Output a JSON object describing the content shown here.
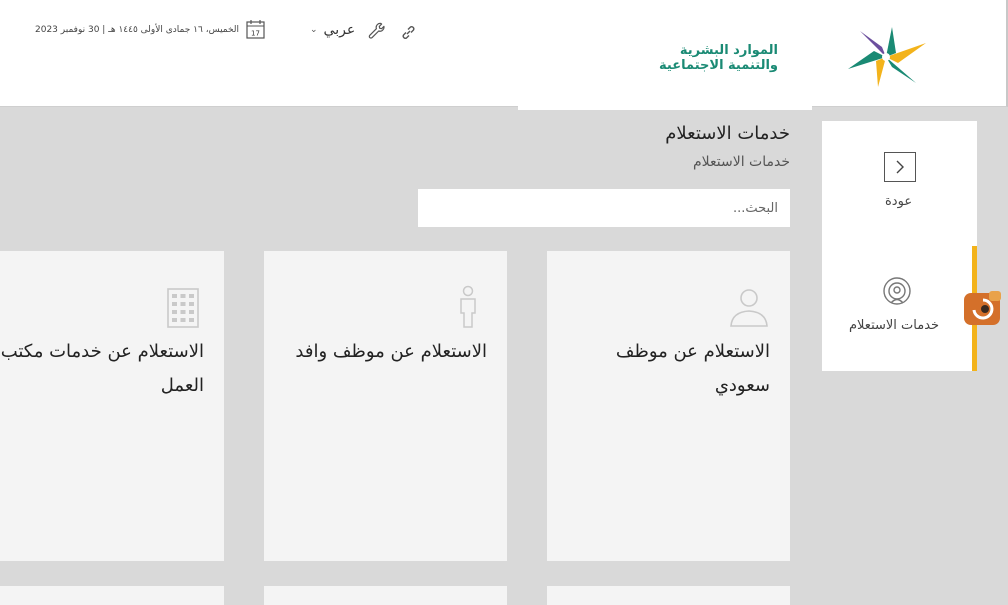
{
  "header": {
    "date": "الخميس، ١٦ جمادى الأولى ١٤٤٥ هـ | 30 نوفمبر 2023",
    "calendar_day": "17",
    "language": "عربي",
    "logo_line1": "الموارد البشرية",
    "logo_line2": "والتنمية الاجتماعية"
  },
  "sidebar": {
    "back_label": "عودة",
    "inquiry_label": "خدمات الاستعلام"
  },
  "main": {
    "title": "خدمات الاستعلام",
    "breadcrumb": "خدمات الاستعلام",
    "search_placeholder": "البحث...",
    "cards": [
      {
        "label": "الاستعلام عن موظف سعودي",
        "icon": "person-icon"
      },
      {
        "label": "الاستعلام عن موظف وافد",
        "icon": "standing-person-icon"
      },
      {
        "label": "الاستعلام عن خدمات مكتب العمل",
        "icon": "building-icon"
      }
    ]
  },
  "colors": {
    "accent": "#f3b31b",
    "brand_green": "#1a8a74",
    "background": "#d9d9d9",
    "card": "#f4f4f4"
  }
}
